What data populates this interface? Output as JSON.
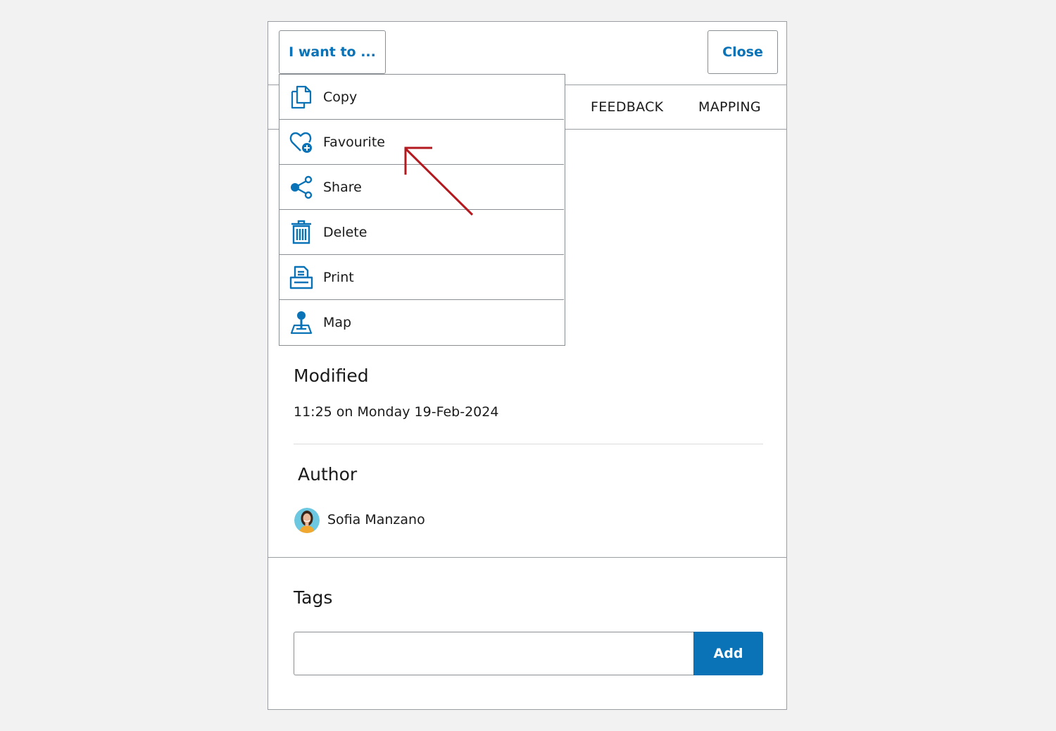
{
  "header": {
    "i_want_to_label": "I want to ...",
    "close_label": "Close"
  },
  "tabs": [
    {
      "label": "FEEDBACK"
    },
    {
      "label": "MAPPING"
    }
  ],
  "menu": {
    "items": [
      {
        "label": "Copy",
        "icon": "copy-icon"
      },
      {
        "label": "Favourite",
        "icon": "heart-plus-icon"
      },
      {
        "label": "Share",
        "icon": "share-icon"
      },
      {
        "label": "Delete",
        "icon": "trash-icon"
      },
      {
        "label": "Print",
        "icon": "printer-icon"
      },
      {
        "label": "Map",
        "icon": "map-pin-icon"
      }
    ]
  },
  "modified": {
    "title": "Modified",
    "value": "11:25 on Monday 19-Feb-2024"
  },
  "author": {
    "title": "Author",
    "name": "Sofia Manzano"
  },
  "tags": {
    "title": "Tags",
    "input_value": "",
    "add_label": "Add"
  },
  "colors": {
    "accent": "#0a73b7",
    "annotation_arrow": "#b3191e",
    "border": "#8a8f94"
  }
}
